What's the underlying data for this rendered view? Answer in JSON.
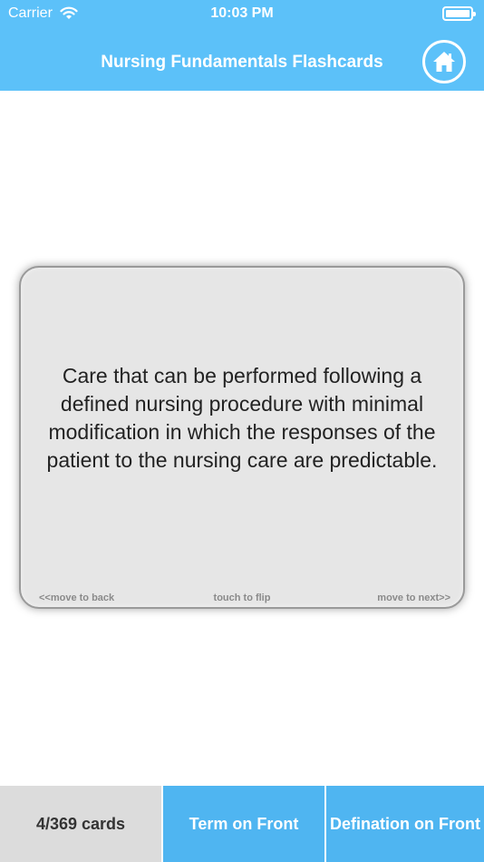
{
  "status_bar": {
    "carrier": "Carrier",
    "time": "10:03 PM"
  },
  "nav": {
    "title": "Nursing Fundamentals Flashcards"
  },
  "card": {
    "text": "Care that can be performed following a defined nursing procedure with minimal modification in which the responses of the patient to the nursing care are predictable.",
    "hint_back": "<<move to back",
    "hint_flip": "touch to flip",
    "hint_next": "move to next>>"
  },
  "bottom_bar": {
    "count": "4/369 cards",
    "term_on_front": "Term on Front",
    "definition_on_front": "Defination on Front"
  },
  "colors": {
    "header": "#5cc1f9",
    "toolbar_button": "#4fb5f1",
    "card_background": "#e6e6e6"
  }
}
